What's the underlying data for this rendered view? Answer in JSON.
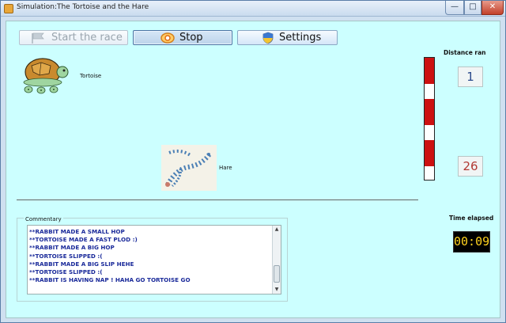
{
  "window": {
    "title": "Simulation:The Tortoise and the Hare",
    "controls": {
      "minimize": "—",
      "maximize": "□",
      "close": "✕"
    }
  },
  "toolbar": {
    "start_label": "Start the race",
    "stop_label": "Stop",
    "settings_label": "Settings"
  },
  "race": {
    "tortoise_label": "Tortoise",
    "hare_label": "Hare",
    "distance_label": "Distance ran",
    "tortoise_distance": "1",
    "hare_distance": "26",
    "time_label": "Time elapsed",
    "time_elapsed": "00:09"
  },
  "commentary": {
    "title": "Commentary",
    "lines": [
      "**RABBIT MADE A SMALL HOP",
      "**TORTOISE MADE A FAST PLOD :)",
      "**RABBIT MADE A BIG HOP",
      "**TORTOISE SLIPPED :(",
      "**RABBIT MADE A BIG SLIP HEHE",
      "**TORTOISE SLIPPED :(",
      "**RABBIT IS HAVING NAP ! HAHA GO TORTOISE GO"
    ]
  },
  "icons": {
    "start": "flag-icon",
    "stop": "stop-icon",
    "settings": "shield-icon"
  },
  "colors": {
    "background": "#ccffff",
    "pole_red": "#cc1111",
    "timer_text": "#ffd21f",
    "log_text": "#1a2a9a"
  }
}
